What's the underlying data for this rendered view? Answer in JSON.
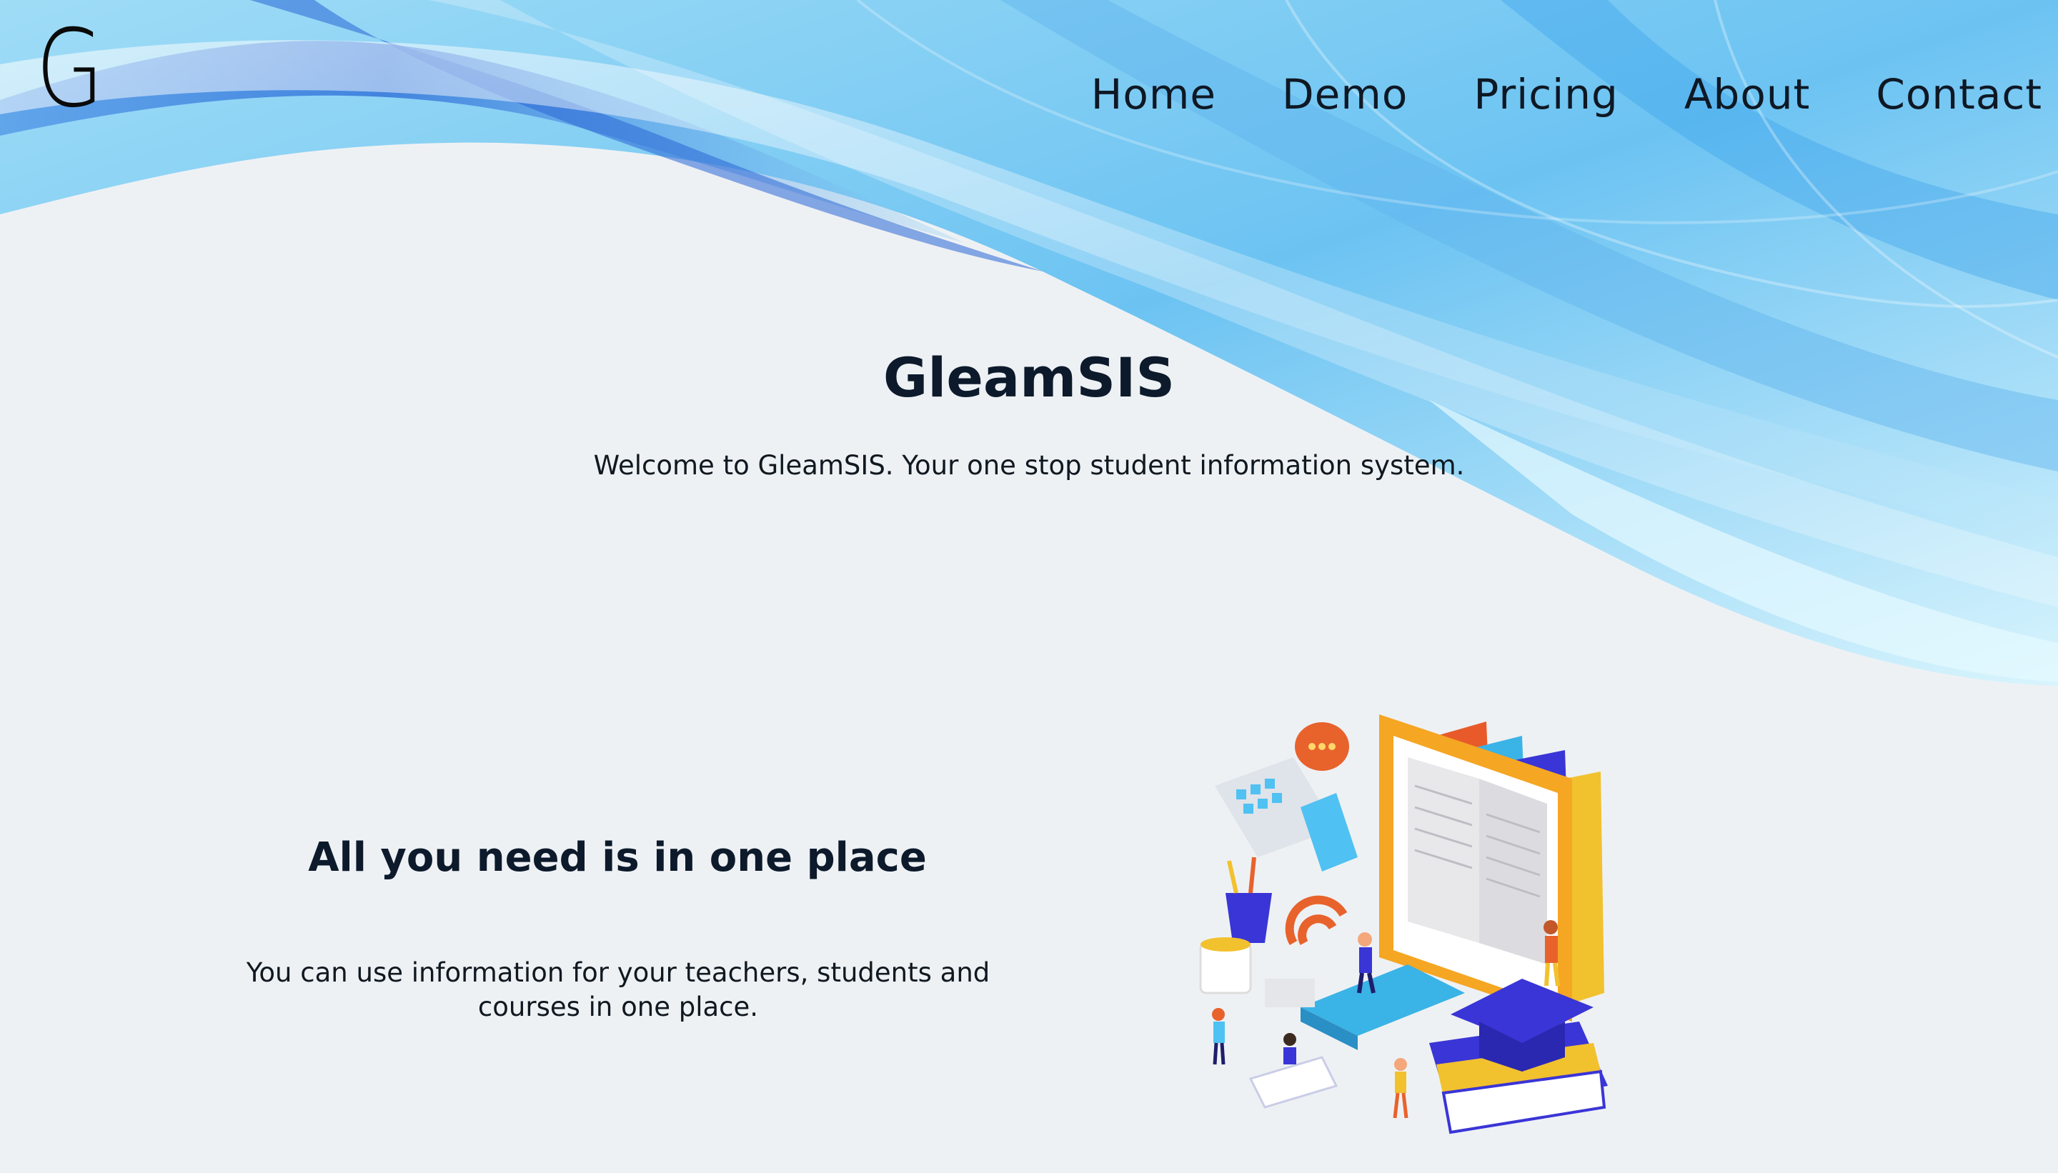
{
  "header": {
    "logo_text": "G",
    "nav": [
      {
        "label": "Home"
      },
      {
        "label": "Demo"
      },
      {
        "label": "Pricing"
      },
      {
        "label": "About"
      },
      {
        "label": "Contact"
      }
    ]
  },
  "hero": {
    "title": "GleamSIS",
    "subtitle": "Welcome to GleamSIS. Your one stop student information system."
  },
  "feature": {
    "title": "All you need is in one place",
    "text": "You can use information for your teachers, students and courses in one place.",
    "illustration_icon": "education-isometric-illustration"
  },
  "colors": {
    "background": "#eef1f4",
    "wave_light": "#bfe7fa",
    "wave_mid": "#5fbdf0",
    "wave_dark": "#2f7fe0",
    "text_dark": "#0c1a2b"
  }
}
